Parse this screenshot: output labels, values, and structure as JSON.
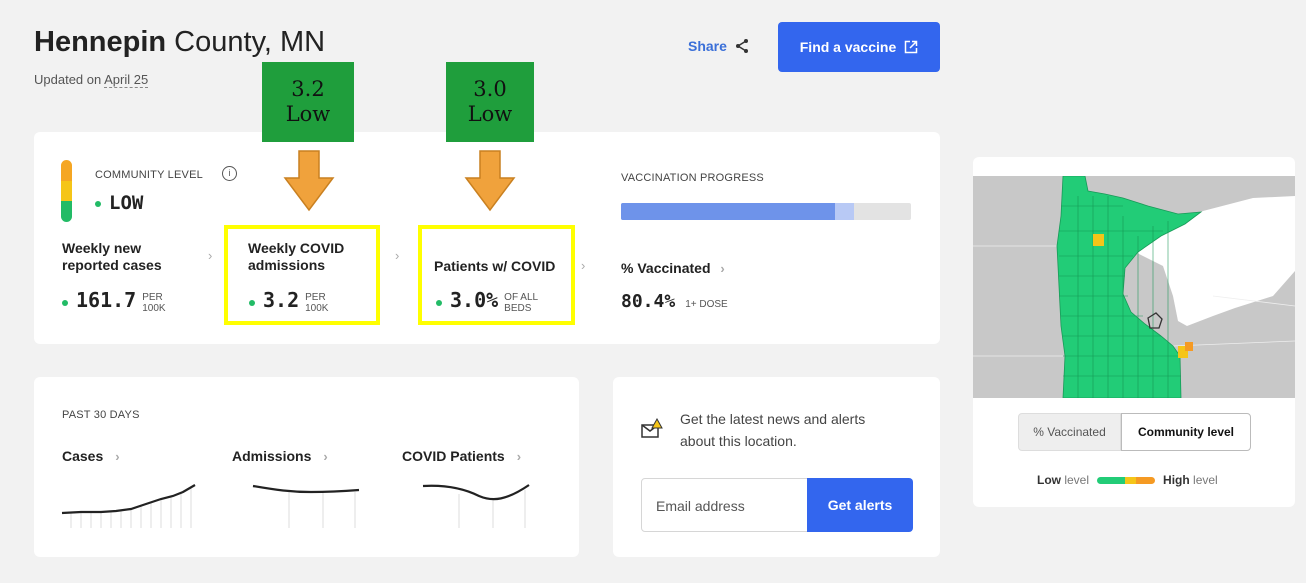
{
  "header": {
    "county_bold": "Hennepin",
    "county_rest": " County, MN",
    "updated_prefix": "Updated on ",
    "updated_date": "April 25",
    "share_label": "Share",
    "find_vaccine_label": "Find a vaccine"
  },
  "annotations": [
    {
      "value": "3.2",
      "level": "Low"
    },
    {
      "value": "3.0",
      "level": "Low"
    }
  ],
  "community": {
    "label": "COMMUNITY LEVEL",
    "level": "LOW",
    "level_bar_colors": [
      "#f5a623",
      "#f5c518",
      "#22bb66"
    ]
  },
  "metrics": [
    {
      "label_line1": "Weekly new",
      "label_line2": "reported cases",
      "value": "161.7",
      "unit_line1": "PER",
      "unit_line2": "100K"
    },
    {
      "label_line1": "Weekly COVID",
      "label_line2": "admissions",
      "value": "3.2",
      "unit_line1": "PER",
      "unit_line2": "100K"
    },
    {
      "label_line1": "Patients w/ COVID",
      "label_line2": "",
      "value": "3.0%",
      "unit_line1": "OF ALL",
      "unit_line2": "BEDS"
    }
  ],
  "vaccination": {
    "title": "VACCINATION PROGRESS",
    "label": "% Vaccinated",
    "value": "80.4%",
    "unit": "1+ DOSE",
    "progress_primary": 0.737,
    "progress_secondary": 0.804
  },
  "past30": {
    "title": "PAST 30 DAYS",
    "charts": [
      {
        "label": "Cases"
      },
      {
        "label": "Admissions"
      },
      {
        "label": "COVID Patients"
      }
    ]
  },
  "alerts": {
    "text_line1": "Get the latest news and alerts",
    "text_line2": "about this location.",
    "email_placeholder": "Email address",
    "button_label": "Get alerts"
  },
  "map": {
    "toggle_vaccinated": "% Vaccinated",
    "toggle_community": "Community level",
    "legend_low": "Low",
    "legend_high": "High",
    "legend_suffix": "level",
    "colors": {
      "low": "#22cc77",
      "medium": "#f5c518",
      "high": "#f59a23",
      "land": "#c8c8c8",
      "water": "#ffffff"
    }
  },
  "colors": {
    "accent": "#3366ee",
    "annotation_green": "#1f9e3c",
    "highlight": "#ffff00",
    "arrow": "#f0a23c"
  }
}
